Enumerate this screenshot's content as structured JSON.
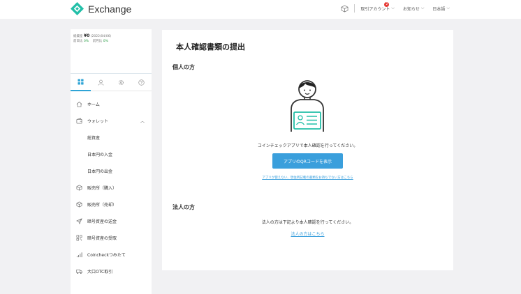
{
  "header": {
    "app_name": "Exchange",
    "nav": [
      {
        "label": "取引アカウント",
        "badge": "2"
      },
      {
        "label": "お知らせ"
      },
      {
        "label": "日本語"
      }
    ]
  },
  "sidebar": {
    "assets": {
      "total_label": "総資産",
      "total_value": "¥0",
      "date": "(2022/04/06)",
      "prev_day_label": "前日比",
      "prev_day_value": "0%",
      "prev_month_label": "前月比",
      "prev_month_value": "0%"
    },
    "tabs": [
      "grid-icon",
      "user-icon",
      "gear-icon",
      "help-icon"
    ],
    "menu": [
      {
        "label": "ホーム",
        "icon": "home-icon"
      },
      {
        "label": "ウォレット",
        "icon": "wallet-icon",
        "expanded": true
      },
      {
        "label": "総資産",
        "sub": true
      },
      {
        "label": "日本円の入金",
        "sub": true
      },
      {
        "label": "日本円の出金",
        "sub": true
      },
      {
        "label": "販売所（購入）",
        "icon": "cube-icon"
      },
      {
        "label": "販売所（売却）",
        "icon": "cube-icon"
      },
      {
        "label": "暗号資産の送金",
        "icon": "send-icon"
      },
      {
        "label": "暗号資産の受取",
        "icon": "qr-icon"
      },
      {
        "label": "Coincheckつみたて",
        "icon": "chart-icon"
      },
      {
        "label": "大口OTC取引",
        "icon": "truck-icon"
      }
    ]
  },
  "main": {
    "title": "本人確認書類の提出",
    "personal": {
      "heading": "個人の方",
      "instruction": "コインチェックアプリで本人確認を行ってください。",
      "button": "アプリのQRコードを表示",
      "link": "アプリが使えない、現住所記載の書類をお持ちでない方はこちら"
    },
    "corporate": {
      "heading": "法人の方",
      "instruction": "法人の方は下記より本人確認を行ってください。",
      "link": "法人の方はこちら"
    }
  },
  "colors": {
    "accent": "#3a9fdc",
    "brand": "#22bfa8",
    "positive": "#2fa04a",
    "badge": "#e53935"
  }
}
